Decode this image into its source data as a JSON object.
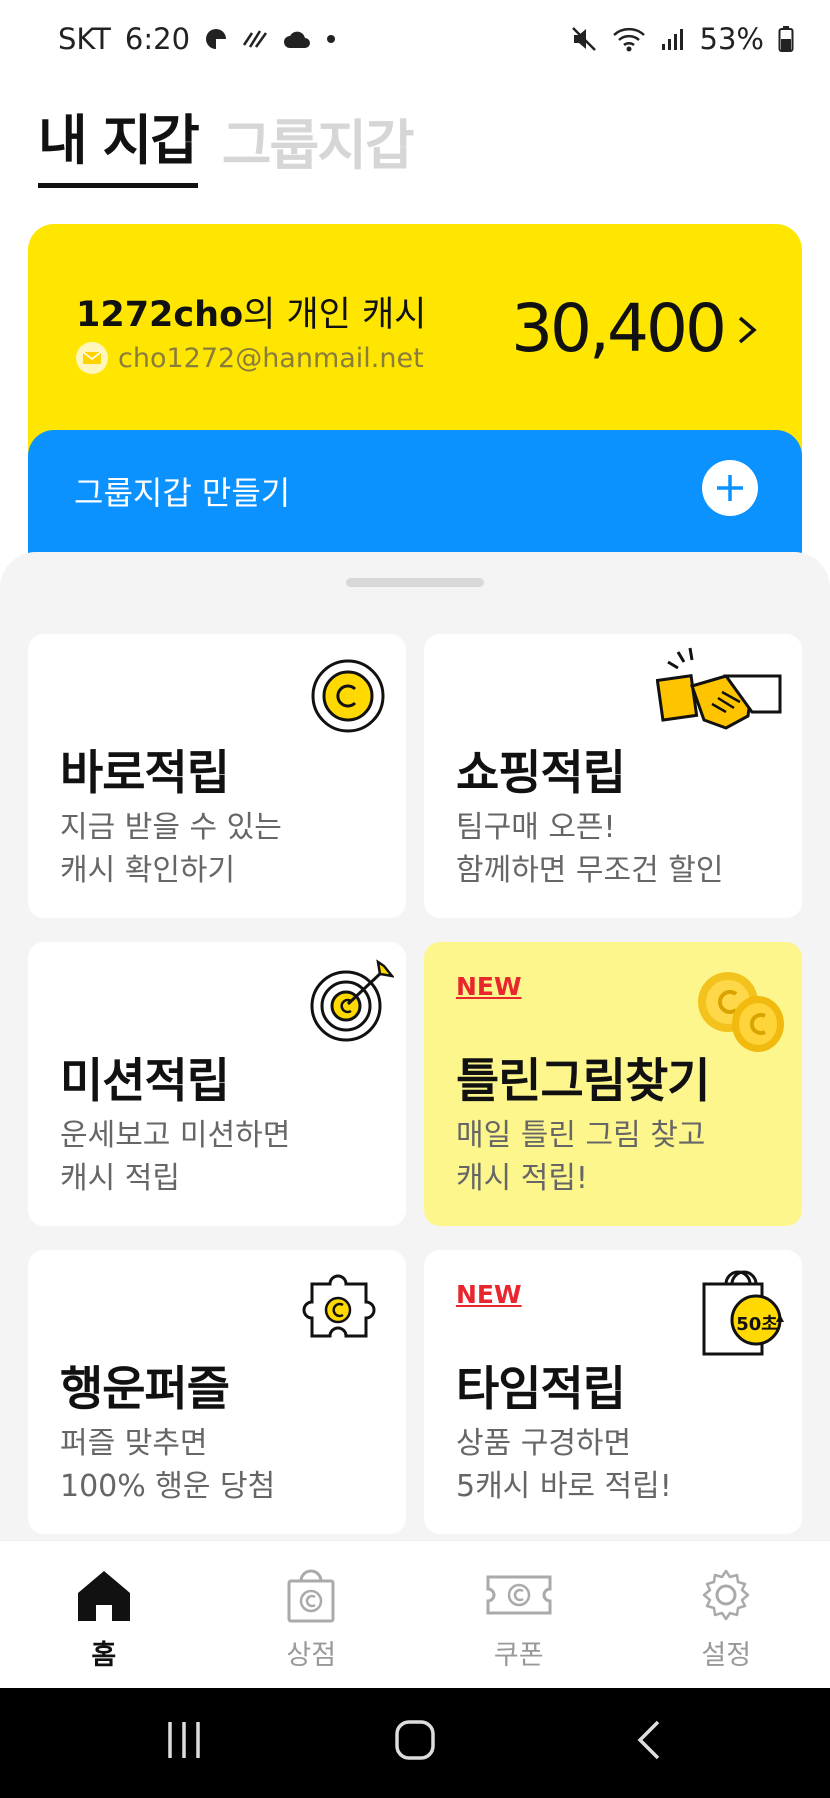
{
  "status_bar": {
    "carrier": "SKT",
    "time": "6:20",
    "battery": "53%"
  },
  "tabs": [
    {
      "label": "내 지갑",
      "active": true
    },
    {
      "label": "그룹지갑",
      "active": false
    }
  ],
  "wallet": {
    "owner_name": "1272cho",
    "owner_suffix": "의 개인 캐시",
    "email": "cho1272@hanmail.net",
    "balance": "30,400",
    "color": "#ffe600"
  },
  "group_wallet": {
    "label": "그룹지갑 만들기",
    "color": "#0b92ff"
  },
  "cards": [
    {
      "title": "바로적립",
      "desc1": "지금 받을 수 있는",
      "desc2": "캐시 확인하기",
      "badge": "",
      "icon": "coin-icon"
    },
    {
      "title": "쇼핑적립",
      "desc1": "팀구매 오픈!",
      "desc2": "함께하면 무조건 할인",
      "badge": "",
      "icon": "handshake-icon"
    },
    {
      "title": "미션적립",
      "desc1": "운세보고 미션하면",
      "desc2": "캐시 적립",
      "badge": "",
      "icon": "target-icon"
    },
    {
      "title": "틀린그림찾기",
      "desc1": "매일 틀린 그림 찾고",
      "desc2": "캐시 적립!",
      "badge": "NEW",
      "icon": "coins-icon"
    },
    {
      "title": "행운퍼즐",
      "desc1": "퍼즐 맞추면",
      "desc2": "100% 행운 당첨",
      "badge": "",
      "icon": "puzzle-icon"
    },
    {
      "title": "타임적립",
      "desc1": "상품 구경하면",
      "desc2": "5캐시 바로 적립!",
      "badge": "NEW",
      "icon": "shopping-bag-timer-icon",
      "timer_label": "50초"
    }
  ],
  "bottom_nav": [
    {
      "label": "홈",
      "icon": "home-icon",
      "active": true
    },
    {
      "label": "상점",
      "icon": "store-bag-icon",
      "active": false
    },
    {
      "label": "쿠폰",
      "icon": "coupon-icon",
      "active": false
    },
    {
      "label": "설정",
      "icon": "gear-icon",
      "active": false
    }
  ]
}
